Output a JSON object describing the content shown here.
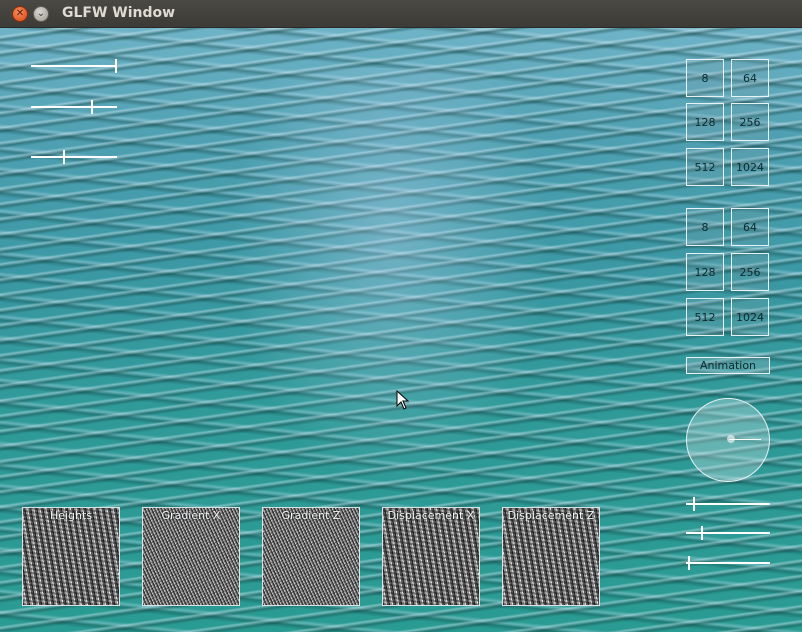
{
  "window": {
    "title": "GLFW Window"
  },
  "resolution_groups": [
    {
      "options": [
        "8",
        "64",
        "128",
        "256",
        "512",
        "1024"
      ]
    },
    {
      "options": [
        "8",
        "64",
        "128",
        "256",
        "512",
        "1024"
      ]
    }
  ],
  "animation_button": {
    "label": "Animation"
  },
  "slider_levels": {
    "top_left": [
      1.0,
      0.72,
      0.38
    ],
    "bottom_right": [
      0.08,
      0.18,
      0.02
    ]
  },
  "textures": [
    {
      "label": "Heights"
    },
    {
      "label": "Gradient X"
    },
    {
      "label": "Gradient Z"
    },
    {
      "label": "Displacement X"
    },
    {
      "label": "Displacement Z"
    }
  ],
  "colors": {
    "water": "#3b98a4",
    "ui_line": "#ffffff",
    "titlebar": "#3c3b37",
    "close_button": "#e0571f"
  },
  "icons": {
    "close": "close-icon",
    "minimize": "chevron-down-icon",
    "cursor": "mouse-pointer-icon"
  }
}
